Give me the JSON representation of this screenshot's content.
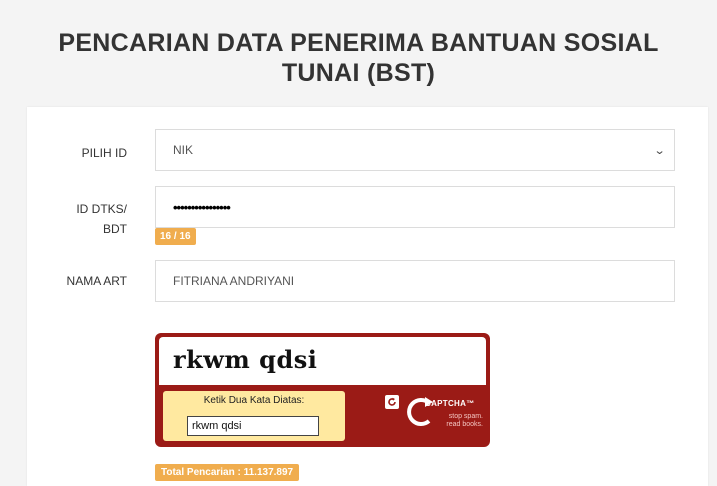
{
  "page": {
    "title_line1": "PENCARIAN DATA PENERIMA BANTUAN SOSIAL",
    "title_line2": "TUNAI (BST)"
  },
  "form": {
    "id_type": {
      "label": "PILIH ID",
      "selected": "NIK"
    },
    "id_number": {
      "label_line1": "ID DTKS/",
      "label_line2": "BDT",
      "masked_value": "••••••••••••••••",
      "counter": "16 / 16"
    },
    "name": {
      "label": "NAMA ART",
      "value": "FITRIANA ANDRIYANI"
    }
  },
  "captcha": {
    "challenge": "rkwm  qdsi",
    "instruction": "Ketik Dua Kata Diatas:",
    "answer": "rkwm qdsi",
    "brand": "CAPTCHA™",
    "tagline_line1": "stop spam.",
    "tagline_line2": "read books.",
    "refresh_icon": "refresh-icon",
    "accent_color": "#9b1b16"
  },
  "stats": {
    "total_search": "Total Pencarian : 11.137.897"
  },
  "colors": {
    "badge": "#f0ad4e",
    "background": "#f4f4f4"
  }
}
